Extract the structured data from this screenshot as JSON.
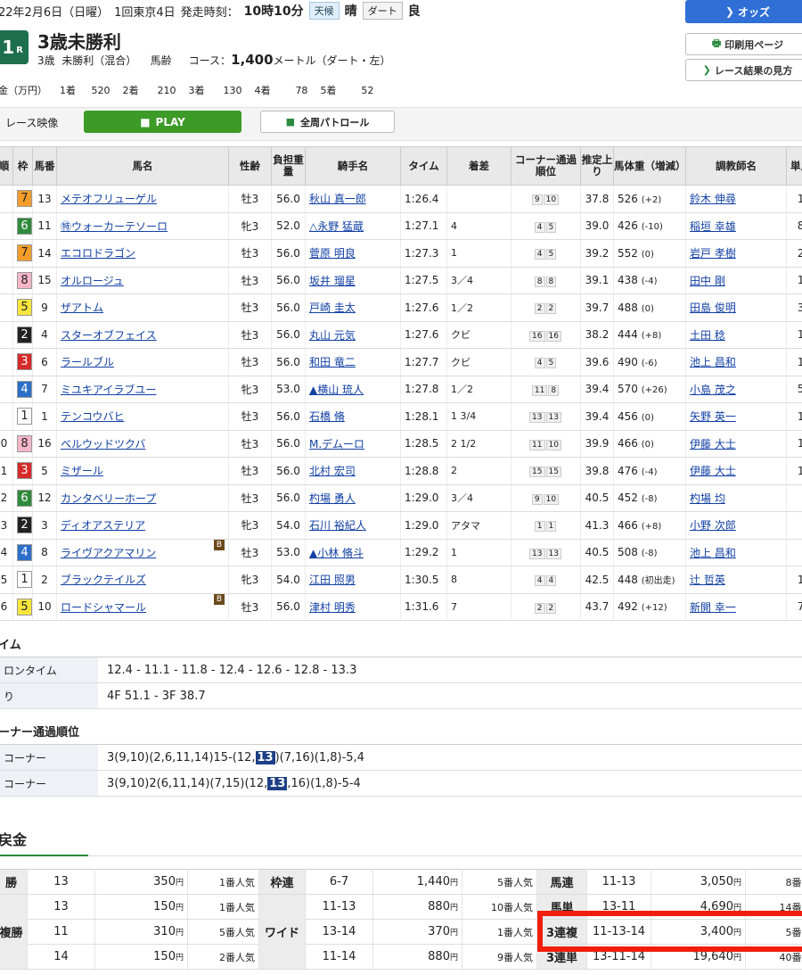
{
  "header": {
    "date": "22年2月6日（日曜）",
    "meeting": "1回東京4日",
    "post_time_label": "発走時刻：",
    "post_time": "10時10分",
    "weather_label": "天候",
    "weather": "晴",
    "track_label": "ダート",
    "track_cond": "良",
    "race_no": "1",
    "race_no_suffix": "R",
    "race_name": "3歳未勝利",
    "info_age": "3歳",
    "info_class": "未勝利（混合）",
    "info_weight": "馬齢",
    "course_label": "コース：",
    "course_dist": "1,400",
    "course_unit": "メートル（ダート・左）"
  },
  "buttons": {
    "odds": "オッズ",
    "print": "印刷用ページ",
    "howto": "レース結果の見方",
    "movie_label": "レース映像",
    "play": "PLAY",
    "patrol": "全周パトロール"
  },
  "prize": {
    "label": "金（万円）",
    "items": [
      {
        "rank": "1着",
        "value": "520"
      },
      {
        "rank": "2着",
        "value": "210"
      },
      {
        "rank": "3着",
        "value": "130"
      },
      {
        "rank": "4着",
        "value": "78"
      },
      {
        "rank": "5着",
        "value": "52"
      }
    ]
  },
  "table_headers": [
    "順",
    "枠",
    "馬番",
    "馬名",
    "性齢",
    "負担重量",
    "騎手名",
    "タイム",
    "着差",
    "コーナー通過順位",
    "推定上り",
    "馬体重（増減）",
    "調教師名",
    "単人"
  ],
  "results": [
    {
      "pos": "",
      "waku": "7",
      "num": "13",
      "horse": "メテオフリューゲル",
      "sex": "牡3",
      "wt": "56.0",
      "jockey": "秋山 真一郎",
      "time": "1:26.4",
      "margin": "",
      "corner": [
        "9",
        "10"
      ],
      "last": "37.8",
      "bw": "526",
      "bwd": "(+2)",
      "trainer": "鈴木 伸尋",
      "pop": "1",
      "blinker": false
    },
    {
      "pos": "",
      "waku": "6",
      "num": "11",
      "horse": "㊕ウォーカーテソーロ",
      "sex": "牝3",
      "wt": "52.0",
      "jockey": "△永野 猛蔵",
      "time": "1:27.1",
      "margin": "4",
      "corner": [
        "4",
        "5"
      ],
      "last": "39.0",
      "bw": "426",
      "bwd": "(-10)",
      "trainer": "稲垣 幸雄",
      "pop": "8",
      "blinker": false
    },
    {
      "pos": "",
      "waku": "7",
      "num": "14",
      "horse": "エコロドラゴン",
      "sex": "牡3",
      "wt": "56.0",
      "jockey": "菅原 明良",
      "time": "1:27.3",
      "margin": "1",
      "corner": [
        "4",
        "5"
      ],
      "last": "39.2",
      "bw": "552",
      "bwd": "(0)",
      "trainer": "岩戸 孝樹",
      "pop": "2",
      "blinker": false
    },
    {
      "pos": "",
      "waku": "8",
      "num": "15",
      "horse": "オルロージュ",
      "sex": "牡3",
      "wt": "56.0",
      "jockey": "坂井 瑠星",
      "time": "1:27.5",
      "margin": "3／4",
      "corner": [
        "8",
        "8"
      ],
      "last": "39.1",
      "bw": "438",
      "bwd": "(-4)",
      "trainer": "田中 剛",
      "pop": "1",
      "blinker": false
    },
    {
      "pos": "",
      "waku": "5",
      "num": "9",
      "horse": "ザアトム",
      "sex": "牡3",
      "wt": "56.0",
      "jockey": "戸崎 圭太",
      "time": "1:27.6",
      "margin": "1／2",
      "corner": [
        "2",
        "2"
      ],
      "last": "39.7",
      "bw": "488",
      "bwd": "(0)",
      "trainer": "田島 俊明",
      "pop": "3",
      "blinker": false
    },
    {
      "pos": "",
      "waku": "2",
      "num": "4",
      "horse": "スターオブフェイス",
      "sex": "牡3",
      "wt": "56.0",
      "jockey": "丸山 元気",
      "time": "1:27.6",
      "margin": "クビ",
      "corner": [
        "16",
        "16"
      ],
      "last": "38.2",
      "bw": "444",
      "bwd": "(+8)",
      "trainer": "土田 稔",
      "pop": "1",
      "blinker": false
    },
    {
      "pos": "",
      "waku": "3",
      "num": "6",
      "horse": "ラールブル",
      "sex": "牡3",
      "wt": "56.0",
      "jockey": "和田 竜二",
      "time": "1:27.7",
      "margin": "クビ",
      "corner": [
        "4",
        "5"
      ],
      "last": "39.6",
      "bw": "490",
      "bwd": "(-6)",
      "trainer": "池上 昌和",
      "pop": "1",
      "blinker": false
    },
    {
      "pos": "",
      "waku": "4",
      "num": "7",
      "horse": "ミユキアイラブユー",
      "sex": "牝3",
      "wt": "53.0",
      "jockey": "▲横山 琉人",
      "time": "1:27.8",
      "margin": "1／2",
      "corner": [
        "11",
        "8"
      ],
      "last": "39.4",
      "bw": "570",
      "bwd": "(+26)",
      "trainer": "小島 茂之",
      "pop": "5",
      "blinker": false
    },
    {
      "pos": "",
      "waku": "1",
      "num": "1",
      "horse": "テンコウバヒ",
      "sex": "牡3",
      "wt": "56.0",
      "jockey": "石橋 脩",
      "time": "1:28.1",
      "margin": "1 3/4",
      "corner": [
        "13",
        "13"
      ],
      "last": "39.4",
      "bw": "456",
      "bwd": "(0)",
      "trainer": "矢野 英一",
      "pop": "1",
      "blinker": false
    },
    {
      "pos": "0",
      "waku": "8",
      "num": "16",
      "horse": "ベルウッドツクバ",
      "sex": "牡3",
      "wt": "56.0",
      "jockey": "M.デムーロ",
      "time": "1:28.5",
      "margin": "2 1/2",
      "corner": [
        "11",
        "10"
      ],
      "last": "39.9",
      "bw": "466",
      "bwd": "(0)",
      "trainer": "伊藤 大士",
      "pop": "1",
      "blinker": false
    },
    {
      "pos": "1",
      "waku": "3",
      "num": "5",
      "horse": "ミザール",
      "sex": "牡3",
      "wt": "56.0",
      "jockey": "北村 宏司",
      "time": "1:28.8",
      "margin": "2",
      "corner": [
        "15",
        "15"
      ],
      "last": "39.8",
      "bw": "476",
      "bwd": "(-4)",
      "trainer": "伊藤 大士",
      "pop": "1",
      "blinker": false
    },
    {
      "pos": "2",
      "waku": "6",
      "num": "12",
      "horse": "カンタベリーホープ",
      "sex": "牡3",
      "wt": "56.0",
      "jockey": "杓場 勇人",
      "time": "1:29.0",
      "margin": "3／4",
      "corner": [
        "9",
        "10"
      ],
      "last": "40.5",
      "bw": "452",
      "bwd": "(-8)",
      "trainer": "杓場 均",
      "pop": "",
      "blinker": false
    },
    {
      "pos": "3",
      "waku": "2",
      "num": "3",
      "horse": "ディオアステリア",
      "sex": "牝3",
      "wt": "54.0",
      "jockey": "石川 裕紀人",
      "time": "1:29.0",
      "margin": "アタマ",
      "corner": [
        "1",
        "1"
      ],
      "last": "41.3",
      "bw": "466",
      "bwd": "(+8)",
      "trainer": "小野 次郎",
      "pop": "",
      "blinker": false
    },
    {
      "pos": "4",
      "waku": "4",
      "num": "8",
      "horse": "ライヴアクアマリン",
      "sex": "牡3",
      "wt": "53.0",
      "jockey": "▲小林 脩斗",
      "time": "1:29.2",
      "margin": "1",
      "corner": [
        "13",
        "13"
      ],
      "last": "40.5",
      "bw": "508",
      "bwd": "(-8)",
      "trainer": "池上 昌和",
      "pop": "",
      "blinker": true
    },
    {
      "pos": "5",
      "waku": "1",
      "num": "2",
      "horse": "ブラックテイルズ",
      "sex": "牝3",
      "wt": "54.0",
      "jockey": "江田 照男",
      "time": "1:30.5",
      "margin": "8",
      "corner": [
        "4",
        "4"
      ],
      "last": "42.5",
      "bw": "448",
      "bwd": "(初出走)",
      "trainer": "辻 哲英",
      "pop": "1",
      "blinker": false
    },
    {
      "pos": "6",
      "waku": "5",
      "num": "10",
      "horse": "ロードシャマール",
      "sex": "牡3",
      "wt": "56.0",
      "jockey": "津村 明秀",
      "time": "1:31.6",
      "margin": "7",
      "corner": [
        "2",
        "2"
      ],
      "last": "43.7",
      "bw": "492",
      "bwd": "(+12)",
      "trainer": "新開 幸一",
      "pop": "7",
      "blinker": true
    }
  ],
  "laps": {
    "title": "イム",
    "rows": [
      {
        "k": "ロンタイム",
        "v": "12.4 - 11.1 - 11.8 - 12.4 - 12.6 - 12.8 - 13.3"
      },
      {
        "k": "り",
        "v": "4F 51.1 - 3F 38.7"
      }
    ]
  },
  "corners": {
    "title": "ーナー通過順位",
    "rows": [
      {
        "k": "コーナー",
        "pre": "3(9,10)(2,6,11,14)15-(12,",
        "hl": "13",
        "post": ")(7,16)(1,8)-5,4"
      },
      {
        "k": "コーナー",
        "pre": "3(9,10)2(6,11,14)(7,15)(12,",
        "hl": "13",
        "post": ",16)(1,8)-5-4"
      }
    ]
  },
  "payout_title": "戻金",
  "payouts": {
    "yen": "円",
    "tansho": {
      "label": "勝",
      "num": "13",
      "amt": "350",
      "ninki": "1番人気"
    },
    "fukusho": {
      "label": "複勝",
      "rows": [
        {
          "num": "13",
          "amt": "150",
          "ninki": "1番人気"
        },
        {
          "num": "11",
          "amt": "310",
          "ninki": "5番人気"
        },
        {
          "num": "14",
          "amt": "150",
          "ninki": "2番人気"
        }
      ]
    },
    "wakuren": {
      "label": "枠連",
      "num": "6-7",
      "amt": "1,440",
      "ninki": "5番人気"
    },
    "wide": {
      "label": "ワイド",
      "rows": [
        {
          "num": "11-13",
          "amt": "880",
          "ninki": "10番人気"
        },
        {
          "num": "13-14",
          "amt": "370",
          "ninki": "1番人気"
        },
        {
          "num": "11-14",
          "amt": "880",
          "ninki": "9番人気"
        }
      ]
    },
    "umaren": {
      "label": "馬連",
      "num": "11-13",
      "amt": "3,050",
      "ninki": "8番人"
    },
    "umatan": {
      "label": "馬単",
      "num": "13-11",
      "amt": "4,690",
      "ninki": "14番人"
    },
    "sanrenpuku": {
      "label": "3連複",
      "num": "11-13-14",
      "amt": "3,400",
      "ninki": "5番人"
    },
    "sanrentan": {
      "label": "3連単",
      "num": "13-11-14",
      "amt": "19,640",
      "ninki": "40番人"
    }
  },
  "colors": {
    "waku": {
      "1": "#ffffff",
      "2": "#222222",
      "3": "#d62a2a",
      "4": "#2c6fc8",
      "5": "#f7e53c",
      "6": "#2f8a3c",
      "7": "#f49d2a",
      "8": "#f6b5c9"
    },
    "highlight": "#f01e0c"
  }
}
